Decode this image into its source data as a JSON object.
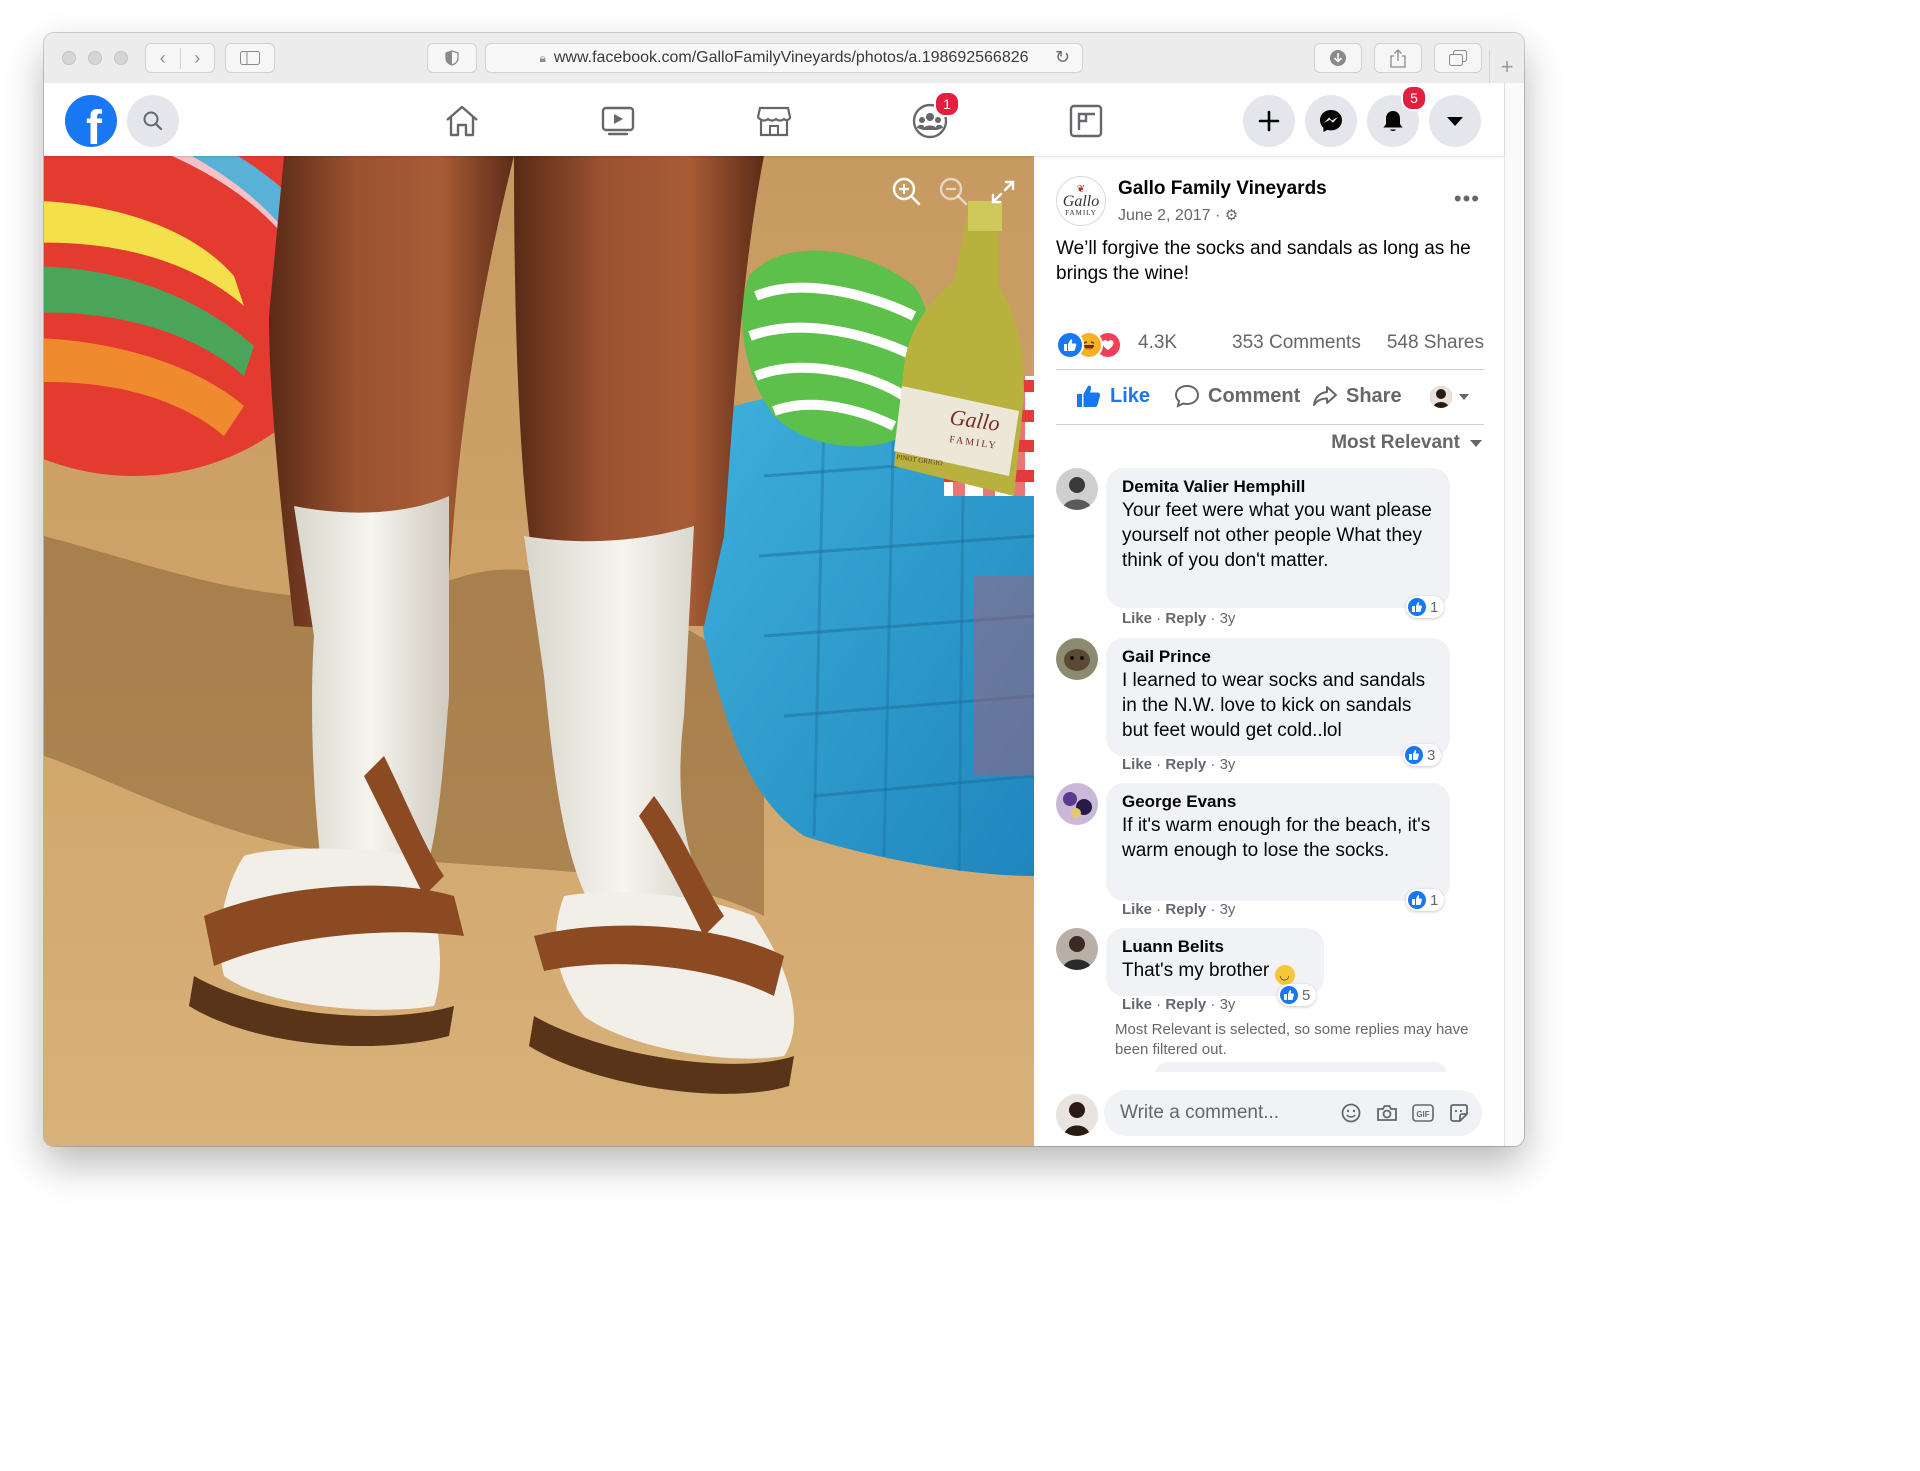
{
  "browser": {
    "url": "www.facebook.com/GalloFamilyVineyards/photos/a.198692566826"
  },
  "header": {
    "notifications_badge": "5",
    "groups_badge": "1"
  },
  "post": {
    "page_name": "Gallo Family Vineyards",
    "avatar_text_line1": "Gallo",
    "avatar_text_line2": "FAMILY",
    "date": "June 2, 2017 ·",
    "text": "We’ll forgive the socks and sandals as long as he brings the wine!",
    "reaction_count": "4.3K",
    "comments_count": "353 Comments",
    "shares_count": "548 Shares",
    "like_label": "Like",
    "comment_label": "Comment",
    "share_label": "Share",
    "sort_label": "Most Relevant"
  },
  "comments": [
    {
      "name": "Demita Valier Hemphill",
      "text": "Your feet were what you want please yourself not other people What they think of you don't matter.",
      "likes": "1",
      "like": "Like",
      "reply": "Reply",
      "age": "3y"
    },
    {
      "name": "Gail Prince",
      "text": "I learned to wear socks and sandals in the N.W. love to kick on sandals but feet would get cold..lol",
      "likes": "3",
      "like": "Like",
      "reply": "Reply",
      "age": "3y"
    },
    {
      "name": "George Evans",
      "text": "If it's warm enough for the beach, it's warm enough to lose the socks.",
      "likes": "1",
      "like": "Like",
      "reply": "Reply",
      "age": "3y"
    },
    {
      "name": "Luann Belits",
      "text": "That's my brother",
      "likes": "5",
      "like": "Like",
      "reply": "Reply",
      "age": "3y"
    }
  ],
  "filter_note": "Most Relevant is selected, so some replies may have been filtered out.",
  "composer": {
    "placeholder": "Write a comment..."
  },
  "photo": {
    "bottle_label_line1": "Gallo",
    "bottle_label_line2": "FAMILY",
    "bottle_label_line3": "PINOT GRIGIO"
  },
  "colors": {
    "brand": "#1877f2",
    "badge": "#e41e3f",
    "secondary_text": "#65676b",
    "bubble": "#f0f2f5"
  }
}
